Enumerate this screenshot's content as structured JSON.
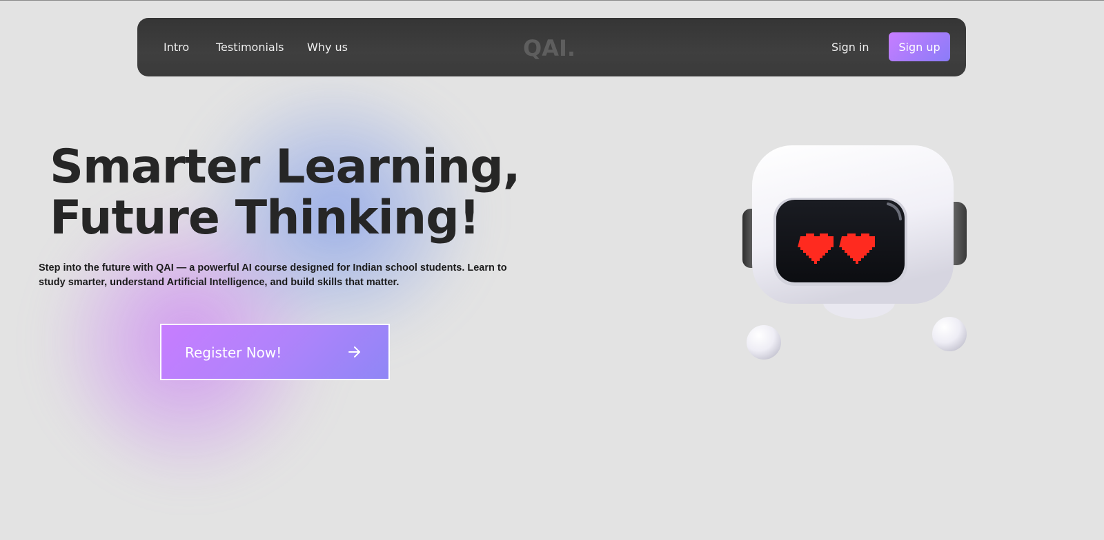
{
  "nav": {
    "links": [
      "Intro",
      "Testimonials",
      "Why us"
    ],
    "logo": "QAI.",
    "signin": "Sign in",
    "signup": "Sign up"
  },
  "hero": {
    "title_line1": "Smarter Learning,",
    "title_line2": "Future Thinking!",
    "subtitle": "Step into the future with QAI — a powerful AI course designed for Indian school students. Learn to study smarter, understand Artificial Intelligence, and build skills that matter.",
    "cta_label": "Register Now!",
    "cta_icon": "arrow-right-icon"
  },
  "illustration": {
    "name": "robot-illustration",
    "eyes": "heart-eyes",
    "eye_color": "#ff2a1f"
  },
  "colors": {
    "background": "#e3e3e3",
    "navbar": "#3a3a3a",
    "accent_start": "#c77dff",
    "accent_end": "#8a7cf8",
    "text_dark": "#262626"
  }
}
